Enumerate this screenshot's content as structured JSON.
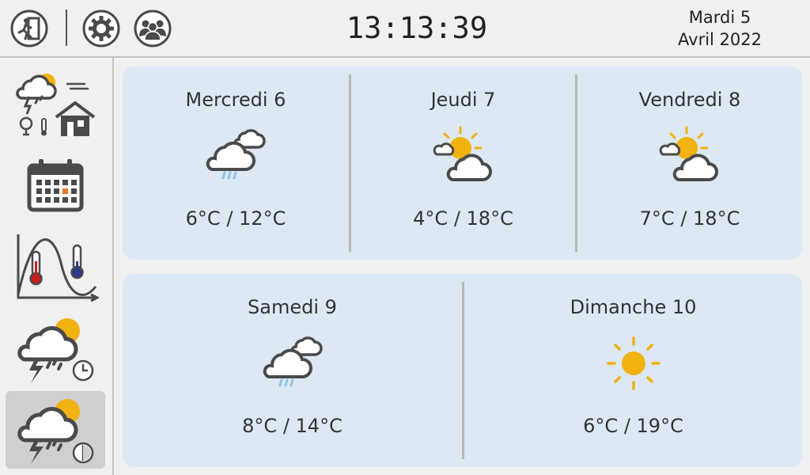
{
  "header": {
    "time": "13:13:39",
    "date_line1": "Mardi 5",
    "date_line2": "Avril 2022",
    "buttons": [
      {
        "icon": "emergency-exit-icon"
      },
      {
        "icon": "gear-icon"
      },
      {
        "icon": "users-icon"
      }
    ]
  },
  "sidebar": {
    "items": [
      {
        "icon": "weather-home-sensors-icon",
        "active": false
      },
      {
        "icon": "calendar-icon",
        "active": false
      },
      {
        "icon": "temperature-curve-icon",
        "active": false
      },
      {
        "icon": "weather-clock-icon",
        "active": false
      },
      {
        "icon": "weather-forecast-icon",
        "active": true
      }
    ]
  },
  "forecast": {
    "top": [
      {
        "day": "Mercredi 6",
        "temp": "6°C / 12°C",
        "icon": "rain-cloud-icon"
      },
      {
        "day": "Jeudi 7",
        "temp": "4°C / 18°C",
        "icon": "partly-cloudy-icon"
      },
      {
        "day": "Vendredi 8",
        "temp": "7°C / 18°C",
        "icon": "partly-cloudy-icon"
      }
    ],
    "bottom": [
      {
        "day": "Samedi 9",
        "temp": "8°C / 14°C",
        "icon": "rain-cloud-icon"
      },
      {
        "day": "Dimanche 10",
        "temp": "6°C / 19°C",
        "icon": "sun-icon"
      }
    ]
  },
  "colors": {
    "panel_bg": "#dde8f5",
    "sun": "#f2b20f",
    "rain": "#8cc4e8",
    "icon_dark": "#4a4a4a",
    "sidebar_active": "#cfcfcf",
    "thermo_hot": "#c81e1e",
    "thermo_cold": "#2a3a8c",
    "calendar_highlight": "#e87a1e"
  }
}
